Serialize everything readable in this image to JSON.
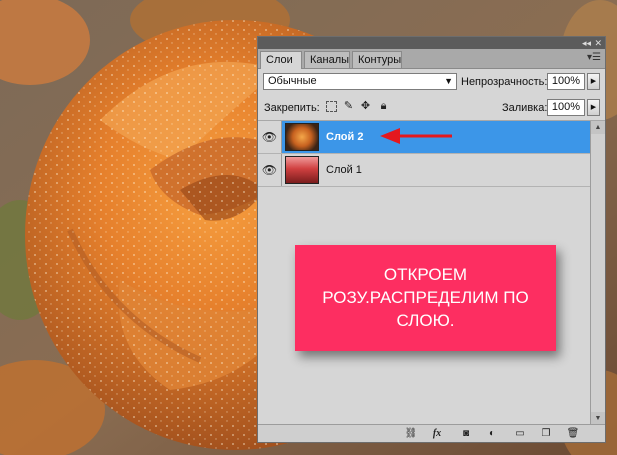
{
  "tabs": [
    "Слои",
    "Каналы",
    "Контуры"
  ],
  "blend_mode": "Обычные",
  "opacity": {
    "label": "Непрозрачность:",
    "value": "100%"
  },
  "fill": {
    "label": "Заливка:",
    "value": "100%"
  },
  "lock_label": "Закрепить:",
  "layers": [
    {
      "name": "Слой 2",
      "selected": true
    },
    {
      "name": "Слой 1",
      "selected": false
    }
  ],
  "note": {
    "lines": [
      "ОТКРОЕМ",
      "РОЗУ.РАСПРЕДЕЛИМ ПО",
      "СЛОЮ."
    ]
  },
  "colors": {
    "selection": "#3c96e8",
    "note_bg": "#fd2e61",
    "arrow": "#e4181e",
    "panel_bg": "#d6d6d6"
  },
  "icons": {
    "eye": "eye-icon",
    "link": "link-icon",
    "fx": "fx-icon",
    "mask": "mask-icon",
    "adjustment": "adjustment-icon",
    "group": "folder-icon",
    "new_layer": "new-layer-icon",
    "delete": "trash-icon"
  }
}
